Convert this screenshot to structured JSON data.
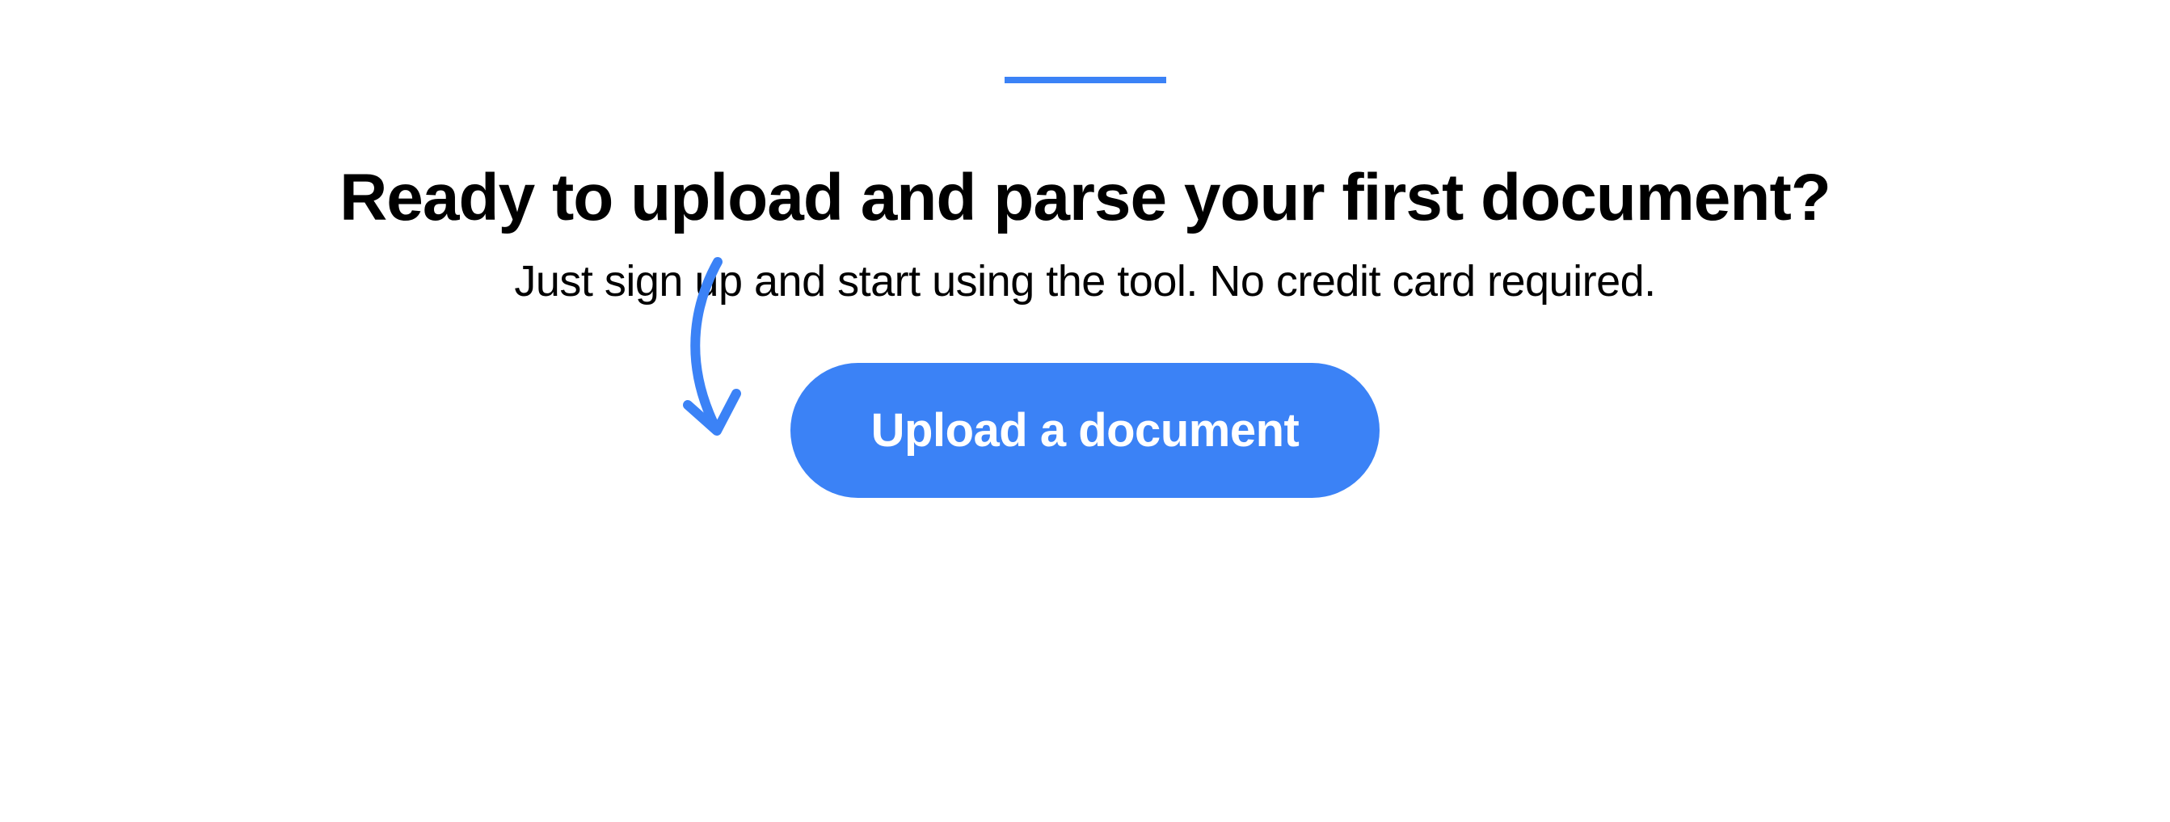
{
  "accent_color": "#3B82F6",
  "heading": "Ready to upload and parse your first document?",
  "subheading": "Just sign up and start using the tool. No credit card required.",
  "cta": {
    "button_label": "Upload a document"
  }
}
